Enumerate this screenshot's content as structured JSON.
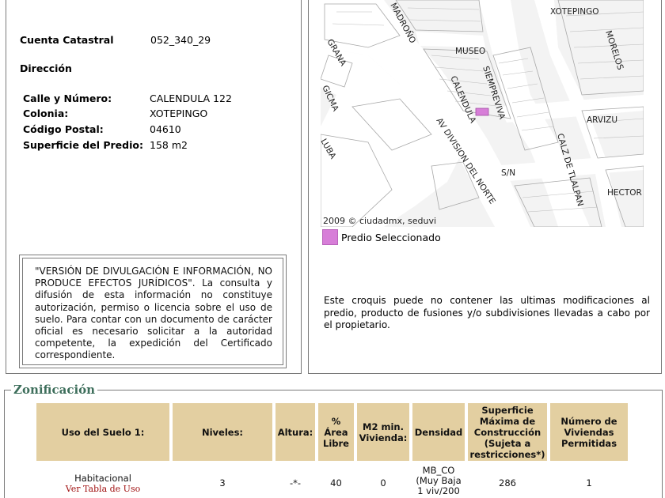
{
  "predio": {
    "cuenta_label": "Cuenta Catastral",
    "cuenta_value": "052_340_29",
    "direccion_label": "Dirección",
    "fields": [
      {
        "label": "Calle y Número:",
        "value": "CALENDULA 122"
      },
      {
        "label": "Colonia:",
        "value": "XOTEPINGO"
      },
      {
        "label": "Código Postal:",
        "value": "04610"
      },
      {
        "label": "Superficie del Predio:",
        "value": "158 m2"
      }
    ]
  },
  "disclaimer": "\"VERSIÓN DE DIVULGACIÓN E INFORMACIÓN, NO PRODUCE EFECTOS JURÍDICOS\". La consulta y difusión de esta información no constituye autorización, permiso o licencia sobre el uso de suelo. Para contar con un documento de carácter oficial es necesario solicitar a la autoridad competente, la expedición del Certificado correspondiente.",
  "map": {
    "attribution": "2009 © ciudadmx, seduvi",
    "legend_label": "Predio Seleccionado",
    "legend_color": "#d77ed8",
    "street_labels": [
      "MADROÑO",
      "XOTEPINGO",
      "MORELOS",
      "GRANA",
      "MUSEO",
      "SIEMPREVIVA",
      "CALENDULA",
      "ARVIZU",
      "GICMA",
      "AV DIVISION DEL NORTE",
      "CALZ DE TLALPAN",
      "S/N",
      "HECTOR",
      "LUBA"
    ],
    "note": "Este croquis puede no contener las ultimas modificaciones al predio, producto de fusiones y/o subdivisiones llevadas a cabo por el propietario."
  },
  "zonificacion": {
    "title": "Zonificación",
    "header_color": "#e3cfa1",
    "headers": [
      "Uso del Suelo 1:",
      "Niveles:",
      "Altura:",
      "% Área Libre",
      "M2 min. Vivienda:",
      "Densidad",
      "Superficie Máxima de Construcción (Sujeta a restricciones*)",
      "Número de Viviendas Permitidas"
    ],
    "row": {
      "uso": "Habitacional",
      "uso_link": "Ver Tabla de Uso",
      "niveles": "3",
      "altura": "-*-",
      "area_libre": "40",
      "m2_min": "0",
      "densidad": "MB_CO (Muy Baja 1 viv/200",
      "superficie": "286",
      "viviendas": "1"
    }
  }
}
